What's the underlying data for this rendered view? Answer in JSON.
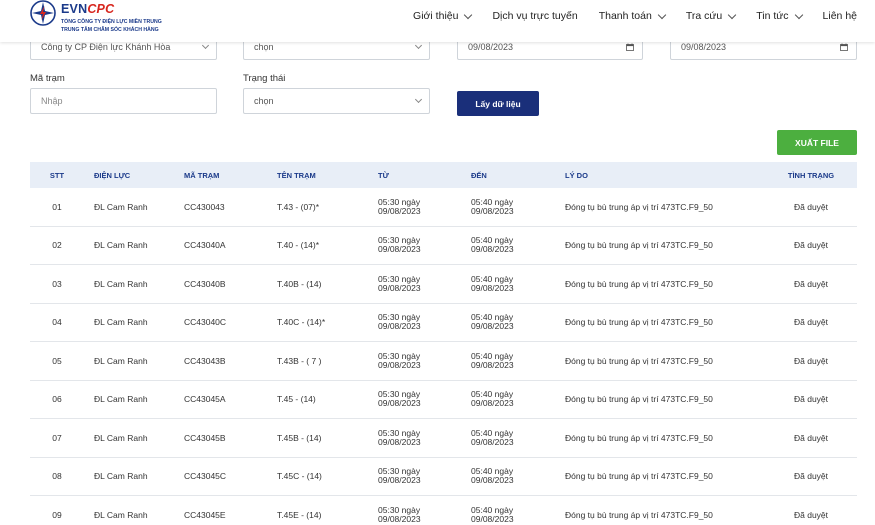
{
  "header": {
    "brand_evn": "EVN",
    "brand_cpc": "CPC",
    "sub_line1": "TỔNG CÔNG TY ĐIỆN LỰC MIỀN TRUNG",
    "sub_line2": "TRUNG TÂM CHĂM SÓC KHÁCH HÀNG",
    "nav": [
      {
        "label": "Giới thiệu"
      },
      {
        "label": "Dịch vụ trực tuyến"
      },
      {
        "label": "Thanh toán"
      },
      {
        "label": "Tra cứu"
      },
      {
        "label": "Tin tức"
      },
      {
        "label": "Liên hệ"
      }
    ]
  },
  "form": {
    "company_value": "Công ty CP Điện lực Khánh Hòa",
    "top_select2_value": "chọn",
    "from_date": "09/08/2023",
    "to_date": "09/08/2023",
    "station_code_label": "Mã trạm",
    "station_code_placeholder": "Nhập",
    "status_label": "Trạng thái",
    "status_value": "chọn",
    "fetch_button": "Lấy dữ liệu",
    "export_button": "XUẤT FILE"
  },
  "table": {
    "headers": [
      "STT",
      "ĐIỆN LỰC",
      "MÃ TRẠM",
      "TÊN TRẠM",
      "TỪ",
      "ĐẾN",
      "LÝ DO",
      "TÌNH TRẠNG"
    ],
    "rows": [
      {
        "stt": "01",
        "dl": "ĐL Cam Ranh",
        "ma": "CC430043",
        "ten": "T.43 - (07)*",
        "tu1": "05:30 ngày",
        "tu2": "09/08/2023",
        "den1": "05:40 ngày",
        "den2": "09/08/2023",
        "ly": "Đóng tụ bù trung áp vị trí 473TC.F9_50",
        "tt": "Đã duyệt"
      },
      {
        "stt": "02",
        "dl": "ĐL Cam Ranh",
        "ma": "CC43040A",
        "ten": "T.40 - (14)*",
        "tu1": "05:30 ngày",
        "tu2": "09/08/2023",
        "den1": "05:40 ngày",
        "den2": "09/08/2023",
        "ly": "Đóng tụ bù trung áp vị trí 473TC.F9_50",
        "tt": "Đã duyệt"
      },
      {
        "stt": "03",
        "dl": "ĐL Cam Ranh",
        "ma": "CC43040B",
        "ten": "T.40B - (14)",
        "tu1": "05:30 ngày",
        "tu2": "09/08/2023",
        "den1": "05:40 ngày",
        "den2": "09/08/2023",
        "ly": "Đóng tụ bù trung áp vị trí 473TC.F9_50",
        "tt": "Đã duyệt"
      },
      {
        "stt": "04",
        "dl": "ĐL Cam Ranh",
        "ma": "CC43040C",
        "ten": "T.40C - (14)*",
        "tu1": "05:30 ngày",
        "tu2": "09/08/2023",
        "den1": "05:40 ngày",
        "den2": "09/08/2023",
        "ly": "Đóng tụ bù trung áp vị trí 473TC.F9_50",
        "tt": "Đã duyệt"
      },
      {
        "stt": "05",
        "dl": "ĐL Cam Ranh",
        "ma": "CC43043B",
        "ten": "T.43B - ( 7 )",
        "tu1": "05:30 ngày",
        "tu2": "09/08/2023",
        "den1": "05:40 ngày",
        "den2": "09/08/2023",
        "ly": "Đóng tụ bù trung áp vị trí 473TC.F9_50",
        "tt": "Đã duyệt"
      },
      {
        "stt": "06",
        "dl": "ĐL Cam Ranh",
        "ma": "CC43045A",
        "ten": "T.45 - (14)",
        "tu1": "05:30 ngày",
        "tu2": "09/08/2023",
        "den1": "05:40 ngày",
        "den2": "09/08/2023",
        "ly": "Đóng tụ bù trung áp vị trí 473TC.F9_50",
        "tt": "Đã duyệt"
      },
      {
        "stt": "07",
        "dl": "ĐL Cam Ranh",
        "ma": "CC43045B",
        "ten": "T.45B - (14)",
        "tu1": "05:30 ngày",
        "tu2": "09/08/2023",
        "den1": "05:40 ngày",
        "den2": "09/08/2023",
        "ly": "Đóng tụ bù trung áp vị trí 473TC.F9_50",
        "tt": "Đã duyệt"
      },
      {
        "stt": "08",
        "dl": "ĐL Cam Ranh",
        "ma": "CC43045C",
        "ten": "T.45C - (14)",
        "tu1": "05:30 ngày",
        "tu2": "09/08/2023",
        "den1": "05:40 ngày",
        "den2": "09/08/2023",
        "ly": "Đóng tụ bù trung áp vị trí 473TC.F9_50",
        "tt": "Đã duyệt"
      },
      {
        "stt": "09",
        "dl": "ĐL Cam Ranh",
        "ma": "CC43045E",
        "ten": "T.45E - (14)",
        "tu1": "05:30 ngày",
        "tu2": "09/08/2023",
        "den1": "05:40 ngày",
        "den2": "09/08/2023",
        "ly": "Đóng tụ bù trung áp vị trí 473TC.F9_50",
        "tt": "Đã duyệt"
      }
    ]
  },
  "colors": {
    "brand_blue": "#1b3a8a",
    "brand_red": "#d7261e",
    "button_navy": "#1a2f7a",
    "button_green": "#4caf3f",
    "table_header_bg": "#e8eef7"
  }
}
